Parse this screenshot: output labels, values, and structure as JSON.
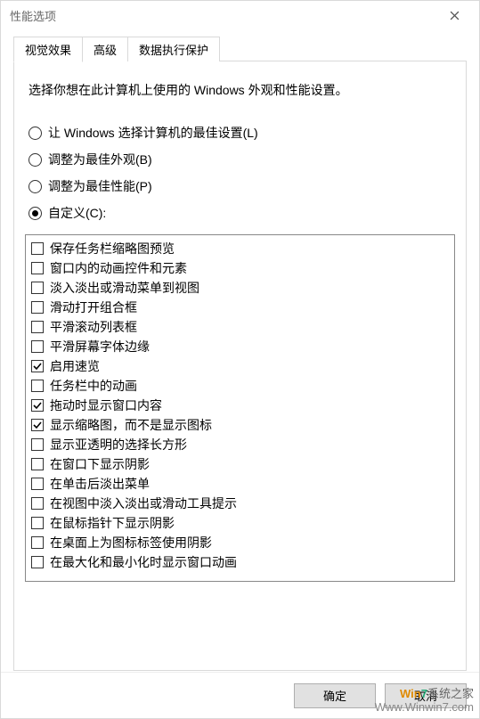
{
  "window": {
    "title": "性能选项"
  },
  "tabs": [
    {
      "label": "视觉效果",
      "active": true
    },
    {
      "label": "高级",
      "active": false
    },
    {
      "label": "数据执行保护",
      "active": false
    }
  ],
  "instruction": "选择你想在此计算机上使用的 Windows 外观和性能设置。",
  "radios": [
    {
      "label": "让 Windows 选择计算机的最佳设置(L)",
      "checked": false
    },
    {
      "label": "调整为最佳外观(B)",
      "checked": false
    },
    {
      "label": "调整为最佳性能(P)",
      "checked": false
    },
    {
      "label": "自定义(C):",
      "checked": true
    }
  ],
  "options": [
    {
      "label": "保存任务栏缩略图预览",
      "checked": false
    },
    {
      "label": "窗口内的动画控件和元素",
      "checked": false
    },
    {
      "label": "淡入淡出或滑动菜单到视图",
      "checked": false
    },
    {
      "label": "滑动打开组合框",
      "checked": false
    },
    {
      "label": "平滑滚动列表框",
      "checked": false
    },
    {
      "label": "平滑屏幕字体边缘",
      "checked": false
    },
    {
      "label": "启用速览",
      "checked": true
    },
    {
      "label": "任务栏中的动画",
      "checked": false
    },
    {
      "label": "拖动时显示窗口内容",
      "checked": true
    },
    {
      "label": "显示缩略图，而不是显示图标",
      "checked": true
    },
    {
      "label": "显示亚透明的选择长方形",
      "checked": false
    },
    {
      "label": "在窗口下显示阴影",
      "checked": false
    },
    {
      "label": "在单击后淡出菜单",
      "checked": false
    },
    {
      "label": "在视图中淡入淡出或滑动工具提示",
      "checked": false
    },
    {
      "label": "在鼠标指针下显示阴影",
      "checked": false
    },
    {
      "label": "在桌面上为图标标签使用阴影",
      "checked": false
    },
    {
      "label": "在最大化和最小化时显示窗口动画",
      "checked": false
    }
  ],
  "buttons": {
    "ok": "确定",
    "cancel": "取消"
  },
  "watermark": {
    "line1": "Win7系统之家",
    "line2": "Www.Winwin7.com"
  }
}
